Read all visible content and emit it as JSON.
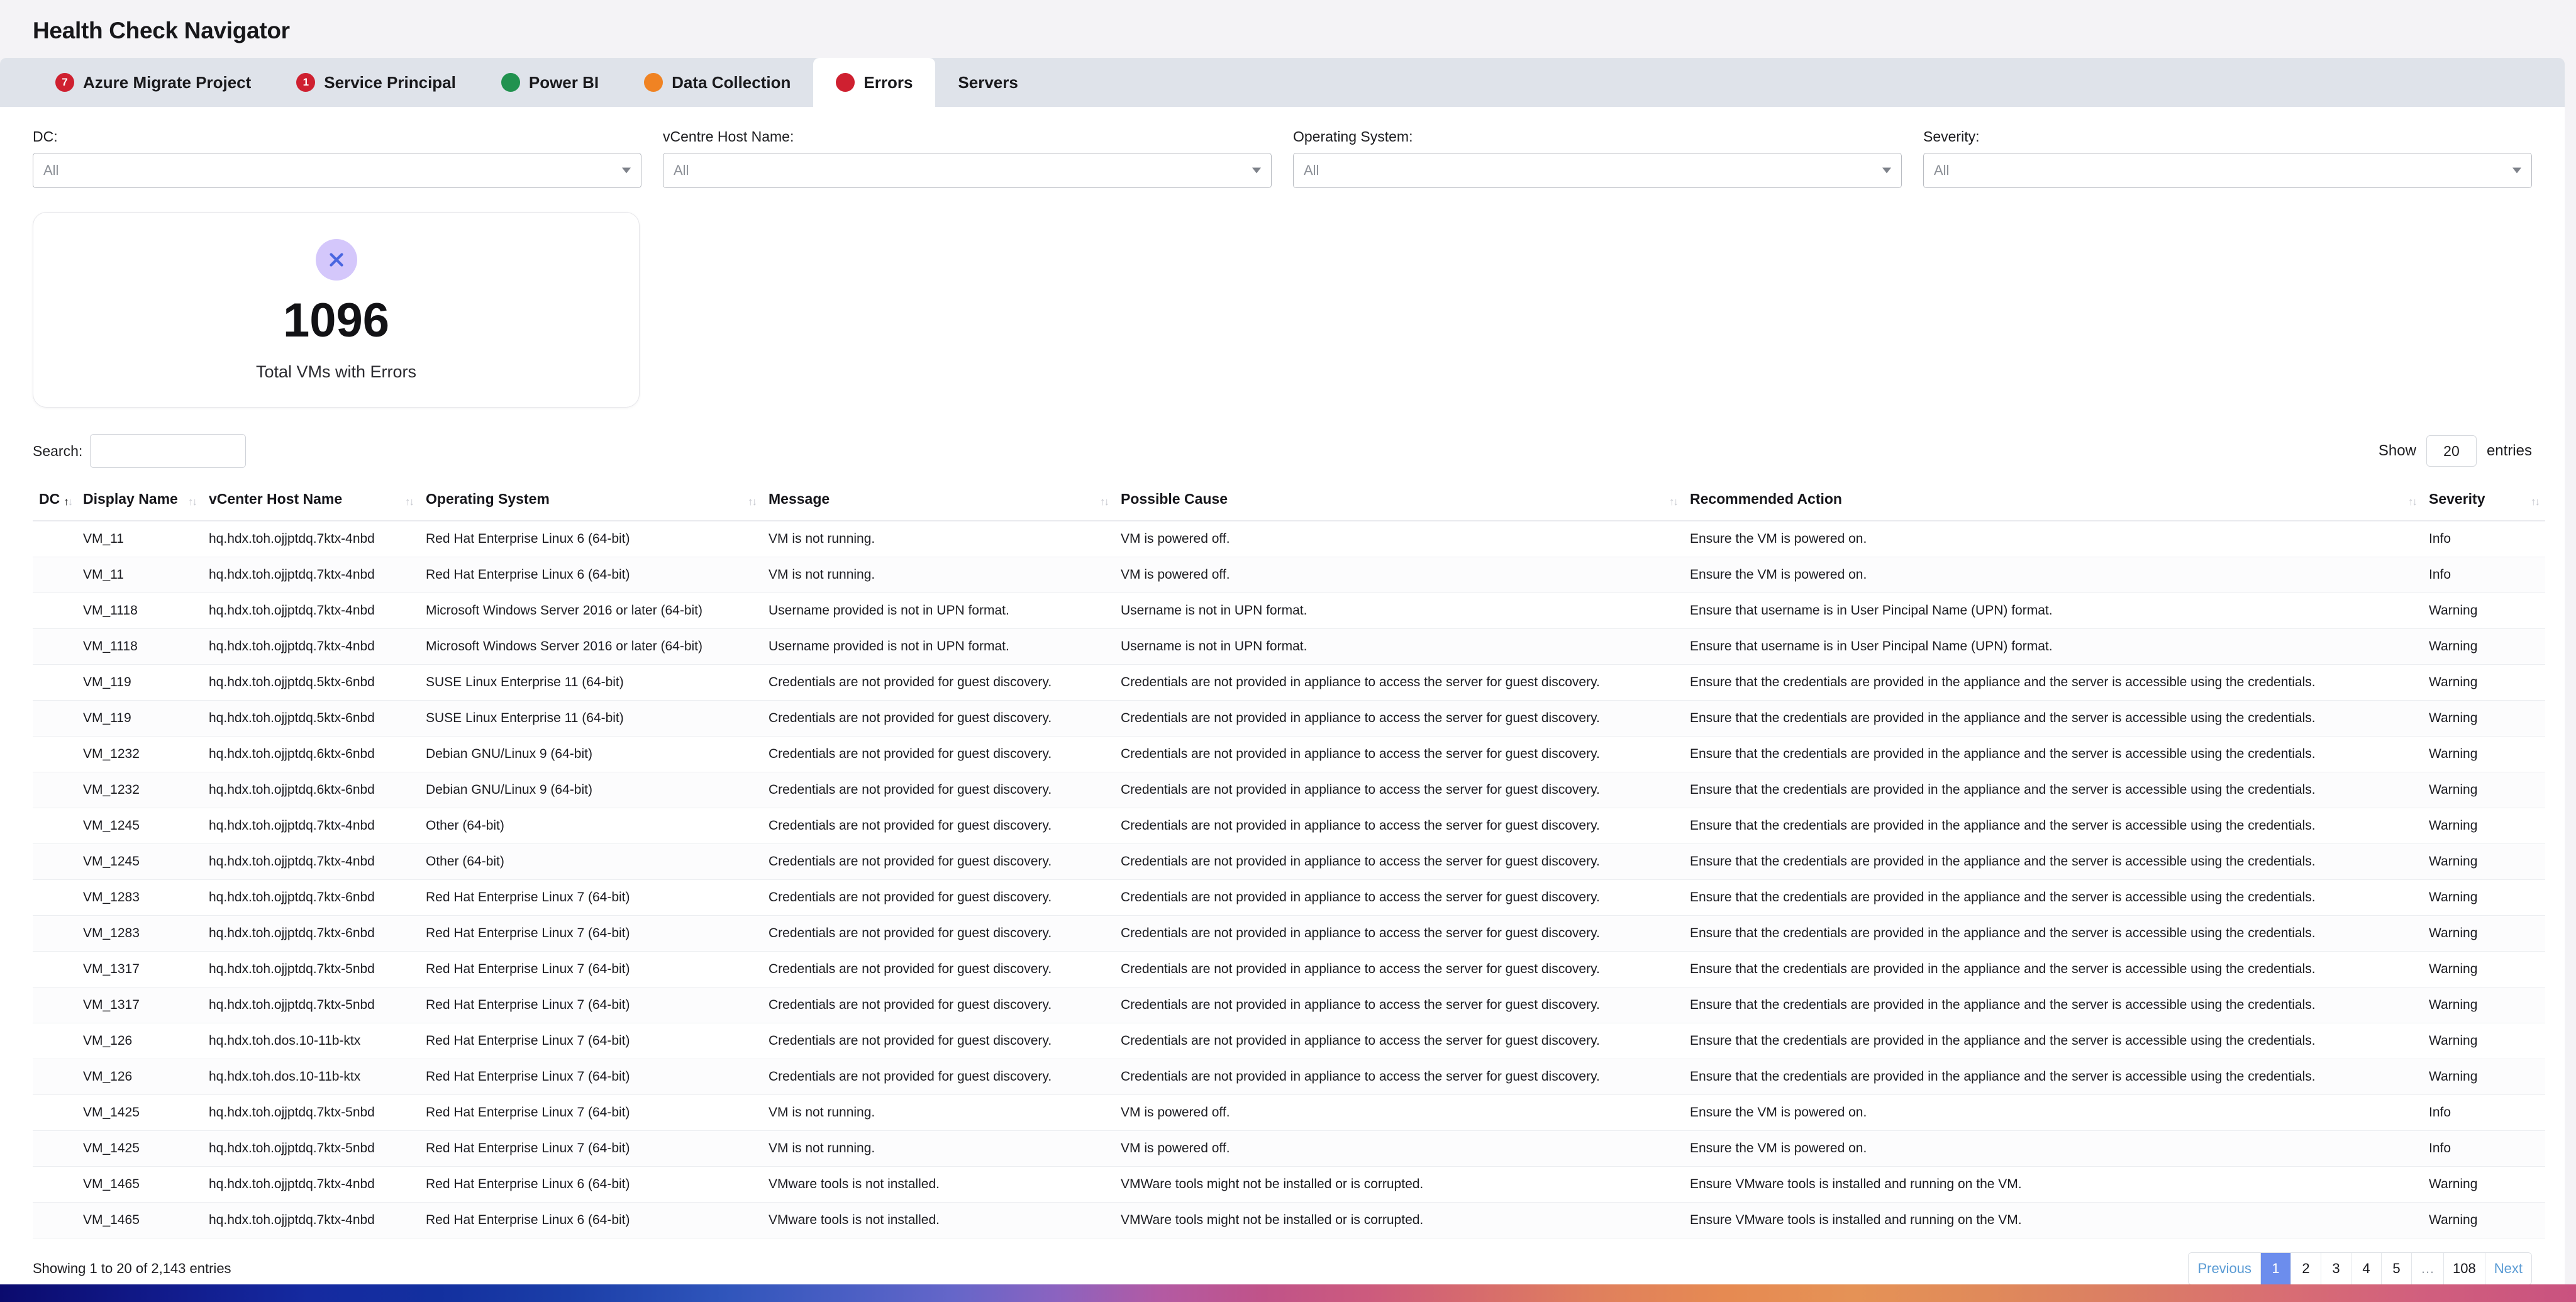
{
  "app": {
    "title": "Health Check Navigator"
  },
  "tabs": [
    {
      "label": "Azure Migrate Project",
      "badge": "7",
      "badge_color": "#cf2030",
      "active": false
    },
    {
      "label": "Service Principal",
      "badge": "1",
      "badge_color": "#cf2030",
      "active": false
    },
    {
      "label": "Power BI",
      "badge": "",
      "badge_color": "#21924f",
      "active": false
    },
    {
      "label": "Data Collection",
      "badge": "",
      "badge_color": "#f08323",
      "active": false
    },
    {
      "label": "Errors",
      "badge": "",
      "badge_color": "#cf2030",
      "active": true
    },
    {
      "label": "Servers",
      "badge": null,
      "badge_color": "",
      "active": false
    }
  ],
  "filters": [
    {
      "label": "DC:",
      "value": "All"
    },
    {
      "label": "vCentre Host Name:",
      "value": "All"
    },
    {
      "label": "Operating System:",
      "value": "All"
    },
    {
      "label": "Severity:",
      "value": "All"
    }
  ],
  "kpi": {
    "icon": "circle-x-icon",
    "value": "1096",
    "label": "Total VMs with Errors",
    "icon_bg": "#d4c7fb",
    "icon_color": "#4a66e0"
  },
  "controls": {
    "search_label": "Search:",
    "search_value": "",
    "search_placeholder": "",
    "show_label": "Show",
    "entries_value": "20",
    "entries_label": "entries"
  },
  "table": {
    "columns": [
      {
        "label": "DC",
        "sorted": "asc"
      },
      {
        "label": "Display Name",
        "sorted": "none"
      },
      {
        "label": "vCenter Host Name",
        "sorted": "none"
      },
      {
        "label": "Operating System",
        "sorted": "none"
      },
      {
        "label": "Message",
        "sorted": "none"
      },
      {
        "label": "Possible Cause",
        "sorted": "none"
      },
      {
        "label": "Recommended Action",
        "sorted": "none"
      },
      {
        "label": "Severity",
        "sorted": "none"
      }
    ],
    "rows": [
      {
        "dc": "",
        "display_name": "VM_11",
        "host": "hq.hdx.toh.ojjptdq.7ktx-4nbd",
        "os": "Red Hat Enterprise Linux 6 (64-bit)",
        "message": "VM is not running.",
        "cause": "VM is powered off.",
        "action": "Ensure the VM is powered on.",
        "severity": "Info"
      },
      {
        "dc": "",
        "display_name": "VM_11",
        "host": "hq.hdx.toh.ojjptdq.7ktx-4nbd",
        "os": "Red Hat Enterprise Linux 6 (64-bit)",
        "message": "VM is not running.",
        "cause": "VM is powered off.",
        "action": "Ensure the VM is powered on.",
        "severity": "Info"
      },
      {
        "dc": "",
        "display_name": "VM_1118",
        "host": "hq.hdx.toh.ojjptdq.7ktx-4nbd",
        "os": "Microsoft Windows Server 2016 or later (64-bit)",
        "message": "Username provided is not in UPN format.",
        "cause": "Username is not in UPN format.",
        "action": "Ensure that username is in User Pincipal Name (UPN) format.",
        "severity": "Warning"
      },
      {
        "dc": "",
        "display_name": "VM_1118",
        "host": "hq.hdx.toh.ojjptdq.7ktx-4nbd",
        "os": "Microsoft Windows Server 2016 or later (64-bit)",
        "message": "Username provided is not in UPN format.",
        "cause": "Username is not in UPN format.",
        "action": "Ensure that username is in User Pincipal Name (UPN) format.",
        "severity": "Warning"
      },
      {
        "dc": "",
        "display_name": "VM_119",
        "host": "hq.hdx.toh.ojjptdq.5ktx-6nbd",
        "os": "SUSE Linux Enterprise 11 (64-bit)",
        "message": "Credentials are not provided for guest discovery.",
        "cause": "Credentials are not provided in appliance to access the server for guest discovery.",
        "action": "Ensure that the credentials are provided in the appliance and the server is accessible using the credentials.",
        "severity": "Warning"
      },
      {
        "dc": "",
        "display_name": "VM_119",
        "host": "hq.hdx.toh.ojjptdq.5ktx-6nbd",
        "os": "SUSE Linux Enterprise 11 (64-bit)",
        "message": "Credentials are not provided for guest discovery.",
        "cause": "Credentials are not provided in appliance to access the server for guest discovery.",
        "action": "Ensure that the credentials are provided in the appliance and the server is accessible using the credentials.",
        "severity": "Warning"
      },
      {
        "dc": "",
        "display_name": "VM_1232",
        "host": "hq.hdx.toh.ojjptdq.6ktx-6nbd",
        "os": "Debian GNU/Linux 9 (64-bit)",
        "message": "Credentials are not provided for guest discovery.",
        "cause": "Credentials are not provided in appliance to access the server for guest discovery.",
        "action": "Ensure that the credentials are provided in the appliance and the server is accessible using the credentials.",
        "severity": "Warning"
      },
      {
        "dc": "",
        "display_name": "VM_1232",
        "host": "hq.hdx.toh.ojjptdq.6ktx-6nbd",
        "os": "Debian GNU/Linux 9 (64-bit)",
        "message": "Credentials are not provided for guest discovery.",
        "cause": "Credentials are not provided in appliance to access the server for guest discovery.",
        "action": "Ensure that the credentials are provided in the appliance and the server is accessible using the credentials.",
        "severity": "Warning"
      },
      {
        "dc": "",
        "display_name": "VM_1245",
        "host": "hq.hdx.toh.ojjptdq.7ktx-4nbd",
        "os": "Other (64-bit)",
        "message": "Credentials are not provided for guest discovery.",
        "cause": "Credentials are not provided in appliance to access the server for guest discovery.",
        "action": "Ensure that the credentials are provided in the appliance and the server is accessible using the credentials.",
        "severity": "Warning"
      },
      {
        "dc": "",
        "display_name": "VM_1245",
        "host": "hq.hdx.toh.ojjptdq.7ktx-4nbd",
        "os": "Other (64-bit)",
        "message": "Credentials are not provided for guest discovery.",
        "cause": "Credentials are not provided in appliance to access the server for guest discovery.",
        "action": "Ensure that the credentials are provided in the appliance and the server is accessible using the credentials.",
        "severity": "Warning"
      },
      {
        "dc": "",
        "display_name": "VM_1283",
        "host": "hq.hdx.toh.ojjptdq.7ktx-6nbd",
        "os": "Red Hat Enterprise Linux 7 (64-bit)",
        "message": "Credentials are not provided for guest discovery.",
        "cause": "Credentials are not provided in appliance to access the server for guest discovery.",
        "action": "Ensure that the credentials are provided in the appliance and the server is accessible using the credentials.",
        "severity": "Warning"
      },
      {
        "dc": "",
        "display_name": "VM_1283",
        "host": "hq.hdx.toh.ojjptdq.7ktx-6nbd",
        "os": "Red Hat Enterprise Linux 7 (64-bit)",
        "message": "Credentials are not provided for guest discovery.",
        "cause": "Credentials are not provided in appliance to access the server for guest discovery.",
        "action": "Ensure that the credentials are provided in the appliance and the server is accessible using the credentials.",
        "severity": "Warning"
      },
      {
        "dc": "",
        "display_name": "VM_1317",
        "host": "hq.hdx.toh.ojjptdq.7ktx-5nbd",
        "os": "Red Hat Enterprise Linux 7 (64-bit)",
        "message": "Credentials are not provided for guest discovery.",
        "cause": "Credentials are not provided in appliance to access the server for guest discovery.",
        "action": "Ensure that the credentials are provided in the appliance and the server is accessible using the credentials.",
        "severity": "Warning"
      },
      {
        "dc": "",
        "display_name": "VM_1317",
        "host": "hq.hdx.toh.ojjptdq.7ktx-5nbd",
        "os": "Red Hat Enterprise Linux 7 (64-bit)",
        "message": "Credentials are not provided for guest discovery.",
        "cause": "Credentials are not provided in appliance to access the server for guest discovery.",
        "action": "Ensure that the credentials are provided in the appliance and the server is accessible using the credentials.",
        "severity": "Warning"
      },
      {
        "dc": "",
        "display_name": "VM_126",
        "host": "hq.hdx.toh.dos.10-11b-ktx",
        "os": "Red Hat Enterprise Linux 7 (64-bit)",
        "message": "Credentials are not provided for guest discovery.",
        "cause": "Credentials are not provided in appliance to access the server for guest discovery.",
        "action": "Ensure that the credentials are provided in the appliance and the server is accessible using the credentials.",
        "severity": "Warning"
      },
      {
        "dc": "",
        "display_name": "VM_126",
        "host": "hq.hdx.toh.dos.10-11b-ktx",
        "os": "Red Hat Enterprise Linux 7 (64-bit)",
        "message": "Credentials are not provided for guest discovery.",
        "cause": "Credentials are not provided in appliance to access the server for guest discovery.",
        "action": "Ensure that the credentials are provided in the appliance and the server is accessible using the credentials.",
        "severity": "Warning"
      },
      {
        "dc": "",
        "display_name": "VM_1425",
        "host": "hq.hdx.toh.ojjptdq.7ktx-5nbd",
        "os": "Red Hat Enterprise Linux 7 (64-bit)",
        "message": "VM is not running.",
        "cause": "VM is powered off.",
        "action": "Ensure the VM is powered on.",
        "severity": "Info"
      },
      {
        "dc": "",
        "display_name": "VM_1425",
        "host": "hq.hdx.toh.ojjptdq.7ktx-5nbd",
        "os": "Red Hat Enterprise Linux 7 (64-bit)",
        "message": "VM is not running.",
        "cause": "VM is powered off.",
        "action": "Ensure the VM is powered on.",
        "severity": "Info"
      },
      {
        "dc": "",
        "display_name": "VM_1465",
        "host": "hq.hdx.toh.ojjptdq.7ktx-4nbd",
        "os": "Red Hat Enterprise Linux 6 (64-bit)",
        "message": "VMware tools is not installed.",
        "cause": "VMWare tools might not be installed or is corrupted.",
        "action": "Ensure VMware tools is installed and running on the VM.",
        "severity": "Warning"
      },
      {
        "dc": "",
        "display_name": "VM_1465",
        "host": "hq.hdx.toh.ojjptdq.7ktx-4nbd",
        "os": "Red Hat Enterprise Linux 6 (64-bit)",
        "message": "VMware tools is not installed.",
        "cause": "VMWare tools might not be installed or is corrupted.",
        "action": "Ensure VMware tools is installed and running on the VM.",
        "severity": "Warning"
      }
    ]
  },
  "footer": {
    "showing_text": "Showing 1 to 20 of 2,143 entries",
    "pagination": [
      {
        "label": "Previous",
        "type": "nav",
        "active": false
      },
      {
        "label": "1",
        "type": "num",
        "active": true
      },
      {
        "label": "2",
        "type": "num",
        "active": false
      },
      {
        "label": "3",
        "type": "num",
        "active": false
      },
      {
        "label": "4",
        "type": "num",
        "active": false
      },
      {
        "label": "5",
        "type": "num",
        "active": false
      },
      {
        "label": "…",
        "type": "ellipsis",
        "active": false
      },
      {
        "label": "108",
        "type": "num",
        "active": false
      },
      {
        "label": "Next",
        "type": "nav",
        "active": false
      }
    ]
  }
}
